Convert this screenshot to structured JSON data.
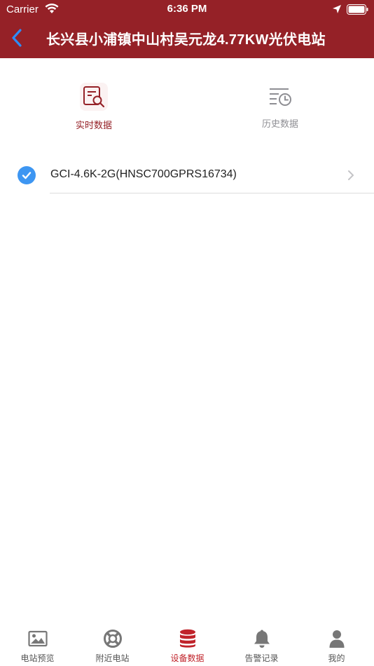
{
  "status_bar": {
    "carrier": "Carrier",
    "time": "6:36 PM"
  },
  "nav": {
    "title": "长兴县小浦镇中山村吴元龙4.77KW光伏电站"
  },
  "tabs": [
    {
      "label": "实时数据",
      "icon": "realtime-search-doc-icon",
      "active": true
    },
    {
      "label": "历史数据",
      "icon": "history-clock-list-icon",
      "active": false
    }
  ],
  "devices": [
    {
      "name": "GCI-4.6K-2G(HNSC700GPRS16734)",
      "selected": true
    }
  ],
  "tabbar": {
    "items": [
      {
        "label": "电站预览",
        "icon": "image-icon",
        "active": false
      },
      {
        "label": "附近电站",
        "icon": "lifebuoy-icon",
        "active": false
      },
      {
        "label": "设备数据",
        "icon": "database-icon",
        "active": true
      },
      {
        "label": "告警记录",
        "icon": "bell-icon",
        "active": false
      },
      {
        "label": "我的",
        "icon": "user-icon",
        "active": false
      }
    ]
  },
  "colors": {
    "brand": "#952127",
    "accent": "#c0232a",
    "check": "#3d96f2",
    "inactive": "#8e8e93"
  }
}
